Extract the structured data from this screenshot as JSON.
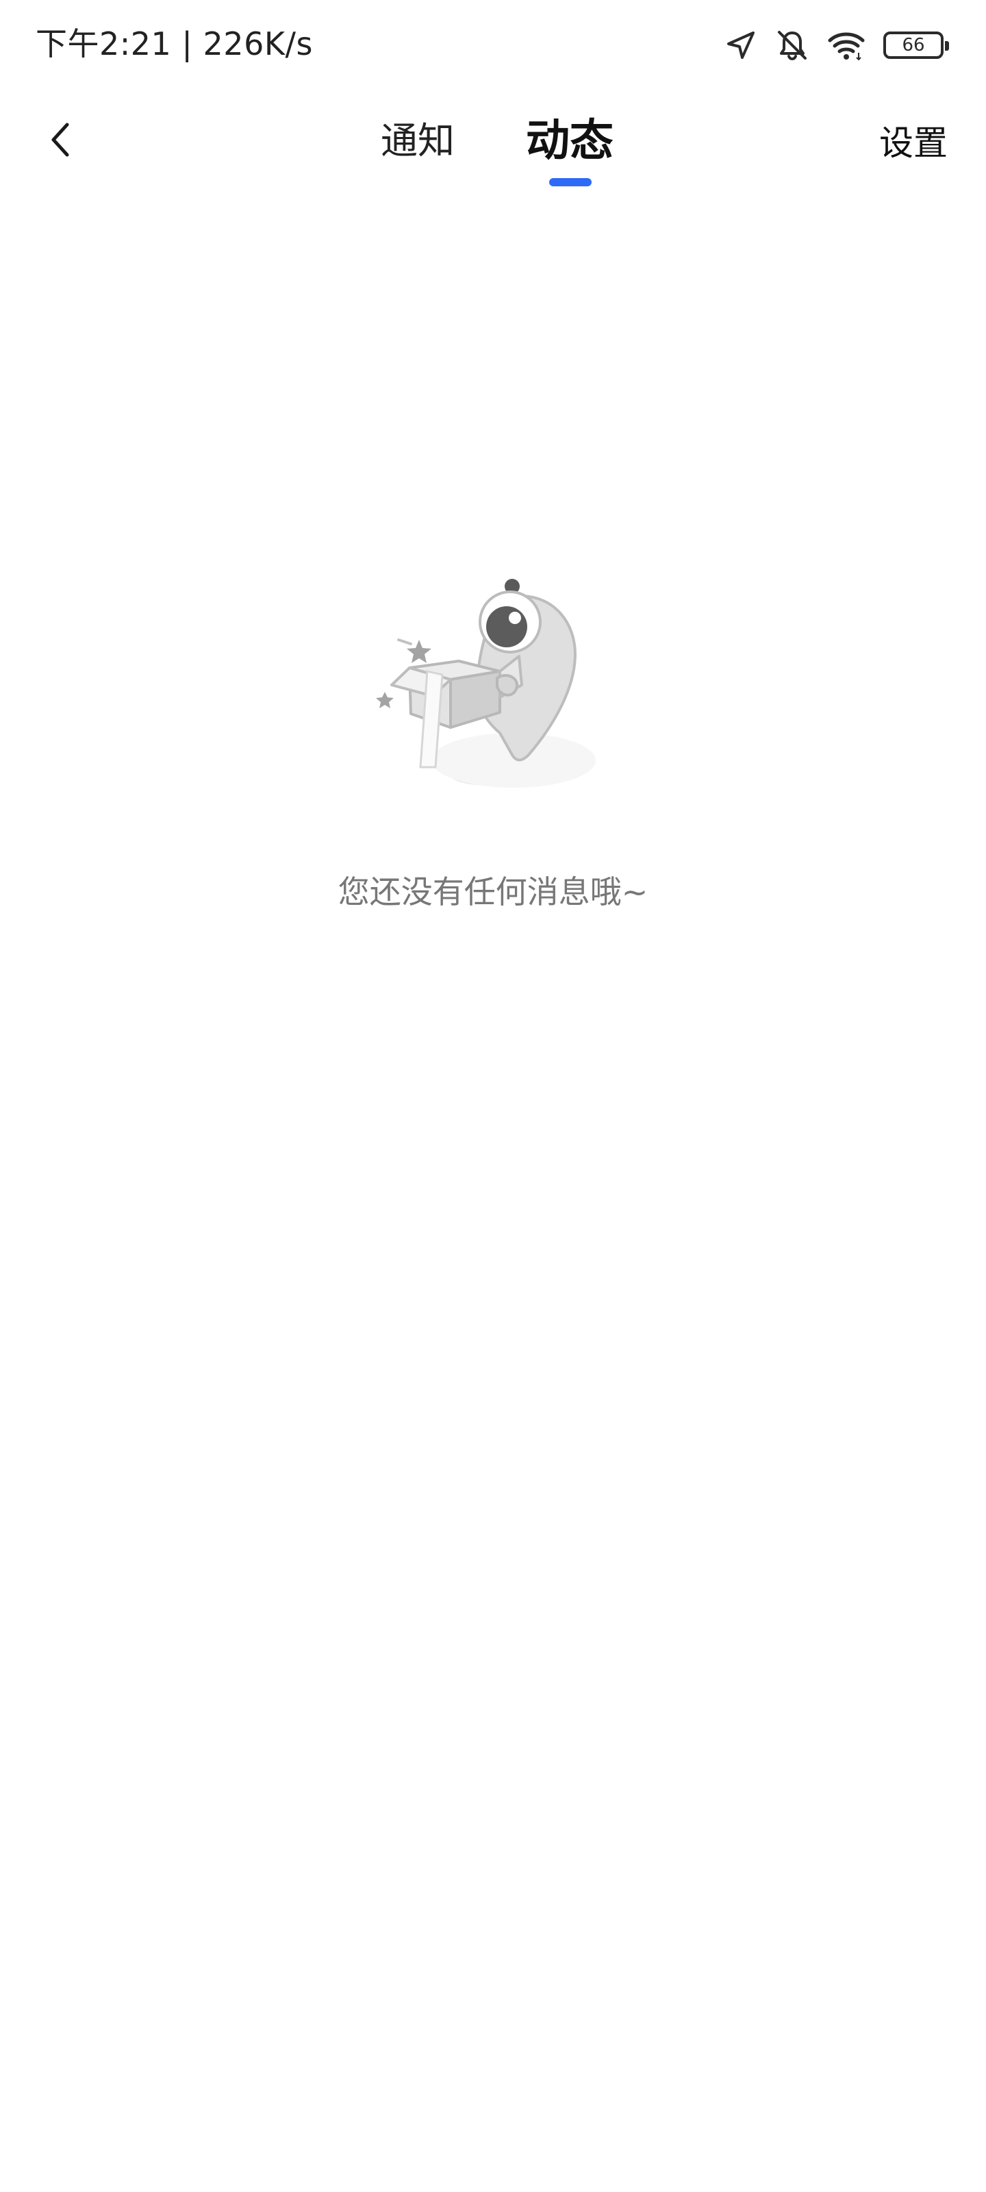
{
  "status_bar": {
    "time_speed": "下午2:21 | 226K/s",
    "battery": "66",
    "icons": [
      "location-icon",
      "bell-off-icon",
      "wifi-icon",
      "battery-icon"
    ]
  },
  "nav": {
    "back_icon": "chevron-left-icon",
    "tabs": [
      {
        "label": "通知",
        "active": false
      },
      {
        "label": "动态",
        "active": true
      }
    ],
    "settings_label": "设置",
    "accent_color": "#2f6af7"
  },
  "empty_state": {
    "illustration": "empty-box-mascot-illustration",
    "message": "您还没有任何消息哦~"
  }
}
